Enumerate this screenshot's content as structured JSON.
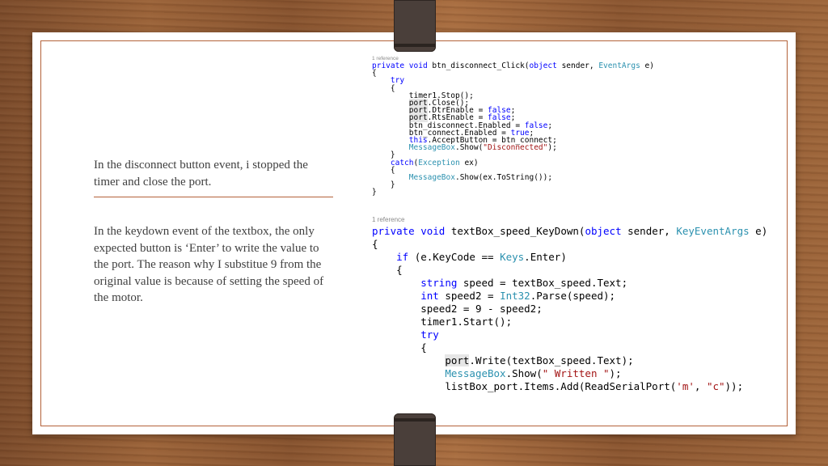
{
  "left_text": {
    "para1": "In the disconnect button event, i stopped the timer and close the port.",
    "para2": "In the keydown event of the textbox, the only expected button is ‘Enter’ to write the value to the port. The reason why I substitue 9 from the original value is because of setting the speed of the motor."
  },
  "code_snippet_1": {
    "ref": "1 reference",
    "l1": {
      "kw1": "private",
      "kw2": "void",
      "name": "btn_disconnect_Click(",
      "kw3": "object",
      "mid": " sender, ",
      "ty": "EventArgs",
      "end": " e)"
    },
    "l2": "{",
    "l3": "try",
    "l4": "{",
    "l5": "timer1.Stop();",
    "l6": {
      "hl": "port",
      "rest": ".Close();"
    },
    "l7": {
      "hl": "port",
      "rest": ".DtrEnable = ",
      "kw": "false",
      "end": ";"
    },
    "l8": {
      "hl": "port",
      "rest": ".RtsEnable = ",
      "kw": "false",
      "end": ";"
    },
    "l9": {
      "rest": "btn_disconnect.Enabled = ",
      "kw": "false",
      "end": ";"
    },
    "l10": {
      "rest": "btn_connect.Enabled = ",
      "kw": "true",
      "end": ";"
    },
    "l11": {
      "kw": "this",
      "rest": ".AcceptButton = btn_connect;"
    },
    "l12": {
      "ty": "MessageBox",
      "rest": ".Show(",
      "st": "\"Disconnected\"",
      "end": ");"
    },
    "l13": "}",
    "l14": {
      "kw": "catch",
      "p1": "(",
      "ty": "Exception",
      "end": " ex)"
    },
    "l15": "{",
    "l16": {
      "ty": "MessageBox",
      "rest": ".Show(ex.ToString());"
    },
    "l17": "}",
    "l18": "}"
  },
  "code_snippet_2": {
    "ref": "1 reference",
    "l1": {
      "kw1": "private",
      "kw2": "void",
      "name": "textBox_speed_KeyDown(",
      "kw3": "object",
      "mid": " sender, ",
      "ty": "KeyEventArgs",
      "end": " e)"
    },
    "l2": "{",
    "l3": {
      "kw": "if",
      "p1": " (e.KeyCode == ",
      "ty": "Keys",
      "end": ".Enter)"
    },
    "l4": "{",
    "l5": {
      "kw": "string",
      "rest": " speed = textBox_speed.Text;"
    },
    "l6": {
      "kw": "int",
      "rest": " speed2 = ",
      "ty": "Int32",
      "end": ".Parse(speed);"
    },
    "l7": "speed2 = 9 - speed2;",
    "l8": "timer1.Start();",
    "l9": "try",
    "l10": "{",
    "l11": {
      "hl": "port",
      "rest": ".Write(textBox_speed.Text);"
    },
    "l12": {
      "ty": "MessageBox",
      "rest": ".Show(",
      "st": "\" Written \"",
      "end": ");"
    },
    "l13": {
      "rest": "listBox_port.Items.Add(ReadSerialPort(",
      "st1": "'m'",
      "mid": ", ",
      "st2": "\"c\"",
      "end": "));"
    }
  }
}
